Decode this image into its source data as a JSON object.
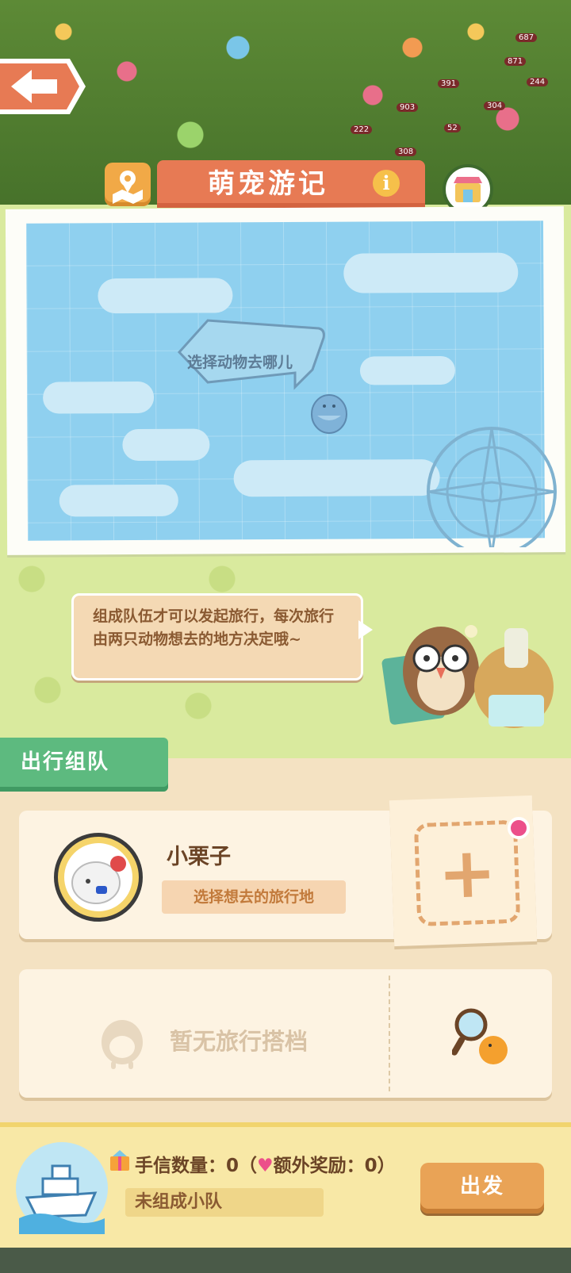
{
  "header": {
    "title": "萌宠游记",
    "info_icon": "info-icon",
    "map_icon": "map-pin-icon",
    "shop_icon": "shop-icon",
    "back_icon": "arrow-left-icon"
  },
  "background_tags": [
    "687",
    "871",
    "244",
    "391",
    "304",
    "903",
    "52",
    "222",
    "308"
  ],
  "map": {
    "prompt": "选择动物去哪儿"
  },
  "tip": {
    "text": "组成队伍才可以发起旅行，每次旅行由两只动物想去的地方决定哦~"
  },
  "team": {
    "section_title": "出行组队",
    "member": {
      "name": "小栗子",
      "destination_placeholder": "选择想去的旅行地"
    },
    "add_slot_icon": "plus-icon",
    "empty_partner_text": "暂无旅行搭档",
    "search_icon": "magnifier-icon"
  },
  "footer": {
    "letter_count_label": "手信数量：0（",
    "heart_icon": "♥",
    "bonus_label": "额外奖励：0）",
    "status": "未组成小队",
    "depart_button": "出发"
  },
  "colors": {
    "title_banner": "#e77a54",
    "section_tab": "#5dba7f",
    "depart_button": "#e9a356",
    "notification_dot": "#ec4f8a"
  }
}
